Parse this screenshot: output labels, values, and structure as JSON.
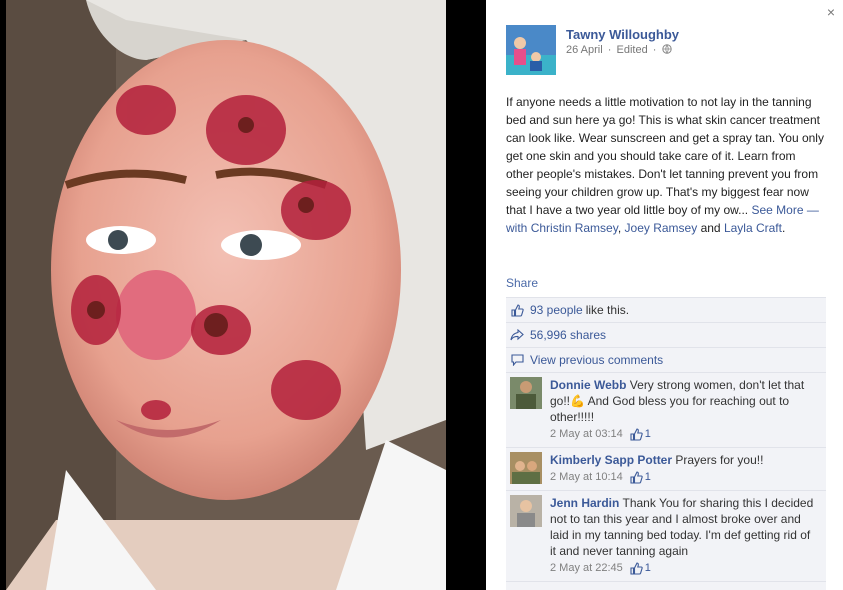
{
  "photo": {
    "icon": "photo"
  },
  "post": {
    "author": "Tawny Willoughby",
    "date": "26 April",
    "edited": "Edited",
    "privacy_icon": "globe-icon",
    "text": "If anyone needs a little motivation to not lay in the tanning bed and sun here ya go! This is what skin cancer treatment can look like. Wear sunscreen and get a spray tan. You only get one skin and you should take care of it. Learn from other people's mistakes. Don't let tanning prevent you from seeing your children grow up. That's my biggest fear now that I have a two year old little boy of my ow...",
    "see_more": "See More",
    "with_prefix": "— with",
    "tag1": "Christin Ramsey",
    "tag_sep": ",",
    "tag2": "Joey Ramsey",
    "tag_and": "and",
    "tag3": "Layla Craft",
    "tag_end": "."
  },
  "actions": {
    "share": "Share",
    "close": "×"
  },
  "ufi": {
    "likes_count": "93 people",
    "likes_suffix": "like this.",
    "shares": "56,996 shares",
    "view_comments": "View previous comments"
  },
  "comments": [
    {
      "name": "Donnie Webb",
      "text": "Very strong women, don't let that go!!💪 And God bless you for reaching out to other!!!!!",
      "time": "2 May at 03:14",
      "likes": "1"
    },
    {
      "name": "Kimberly Sapp Potter",
      "text": "Prayers for you!!",
      "time": "2 May at 10:14",
      "likes": "1"
    },
    {
      "name": "Jenn Hardin",
      "text": "Thank You for sharing this I decided not to tan this year and I almost broke over and laid in my tanning bed today. I'm def getting rid of it and never tanning again",
      "time": "2 May at 22:45",
      "likes": "1"
    }
  ],
  "colors": {
    "link": "#3b5998",
    "ufi_bg": "#f2f3f7"
  }
}
